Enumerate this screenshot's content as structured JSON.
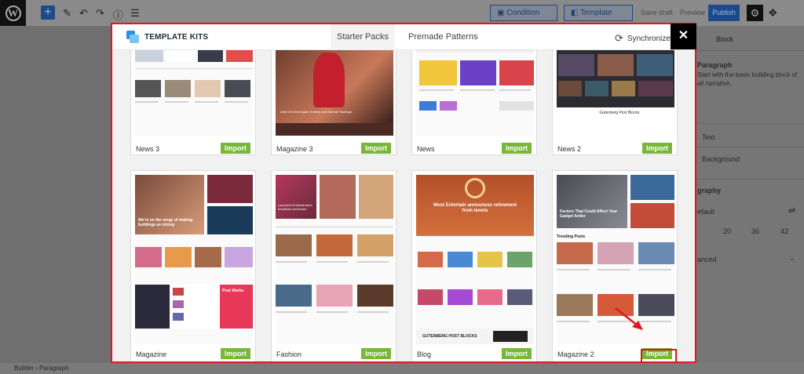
{
  "editor": {
    "condition_label": "Condition",
    "template_kits_label": "Template Kits",
    "save_draft_label": "Save draft",
    "preview_label": "Preview",
    "publish_label": "Publish",
    "sidebar": {
      "block_tab": "Block",
      "paragraph_title": "Paragraph",
      "paragraph_desc_1": "Start with the basic building block of",
      "paragraph_desc_2": "all narrative.",
      "text_label": "Text",
      "background_label": "Background",
      "typography_label": "graphy",
      "default_label": "efault",
      "sizes": [
        "20",
        "36",
        "42"
      ],
      "advanced_label": "anced"
    },
    "breadcrumb": [
      "Builder",
      "Paragraph"
    ]
  },
  "modal": {
    "title": "TEMPLATE KITS",
    "tabs": [
      {
        "label": "Starter Packs",
        "active": true
      },
      {
        "label": "Premade Patterns",
        "active": false
      }
    ],
    "sync_label": "Synchronize",
    "close_glyph": "✕",
    "import_label": "Import",
    "cards_row1": [
      {
        "name": "News 3"
      },
      {
        "name": "Magazine 3"
      },
      {
        "name": "News"
      },
      {
        "name": "News 2"
      }
    ],
    "cards_row2": [
      {
        "name": "Magazine"
      },
      {
        "name": "Fashion"
      },
      {
        "name": "Blog"
      },
      {
        "name": "Magazine 2"
      }
    ],
    "thumb_text": {
      "magazine3_headline": "Until We Meet Again Dreamy And Surreal Paintings",
      "magazine_headline": "We're on the verge of making buildings as strong",
      "magazine_brand": "Post Works",
      "fashion_headline": "Launched Entertainment headlines and brand",
      "blog_headline": "Most Entertain announces retirement from tennis",
      "blog_footer": "GUTENBERG POST BLOCKS",
      "magazine2_headline": "Factors That Could Affect Your Gadget Antler",
      "magazine2_section": "Trending Posts",
      "news2_brand": "Gutenberg Post Blocks"
    },
    "colors": {
      "accent_green": "#78b73a",
      "highlight_red": "#e4161d",
      "wp_blue": "#1e4a8c"
    }
  }
}
